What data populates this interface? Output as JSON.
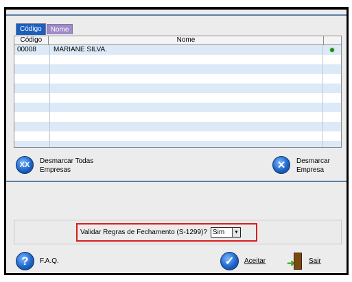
{
  "tabs": [
    {
      "label": "Código",
      "active": true
    },
    {
      "label": "Nome",
      "active": false
    }
  ],
  "grid": {
    "columns": [
      "Código",
      "Nome",
      ""
    ],
    "rows": [
      {
        "codigo": "00008",
        "nome": "MARIANE SILVA.",
        "selected": true
      }
    ],
    "empty_rows": 10
  },
  "actions": {
    "desmarcar_todas": {
      "line1": "Desmarcar Todas",
      "line2": "Empresas",
      "icon": "double-x-icon"
    },
    "desmarcar_empresa": {
      "line1": "Desmarcar",
      "line2": "Empresa",
      "icon": "x-circle-icon"
    }
  },
  "options": {
    "question": "Validar Regras de Fechamento (S-1299)?",
    "selected": "Sim"
  },
  "footer": {
    "faq": "F.A.Q.",
    "aceitar": "Aceitar",
    "sair": "Sair"
  },
  "colors": {
    "tab_active": "#1d5fbf",
    "tab_inactive": "#a08ac8",
    "row_alt": "#dce9f7",
    "highlight_border": "#d91c1c",
    "selected_dot": "#1f8a1f"
  }
}
